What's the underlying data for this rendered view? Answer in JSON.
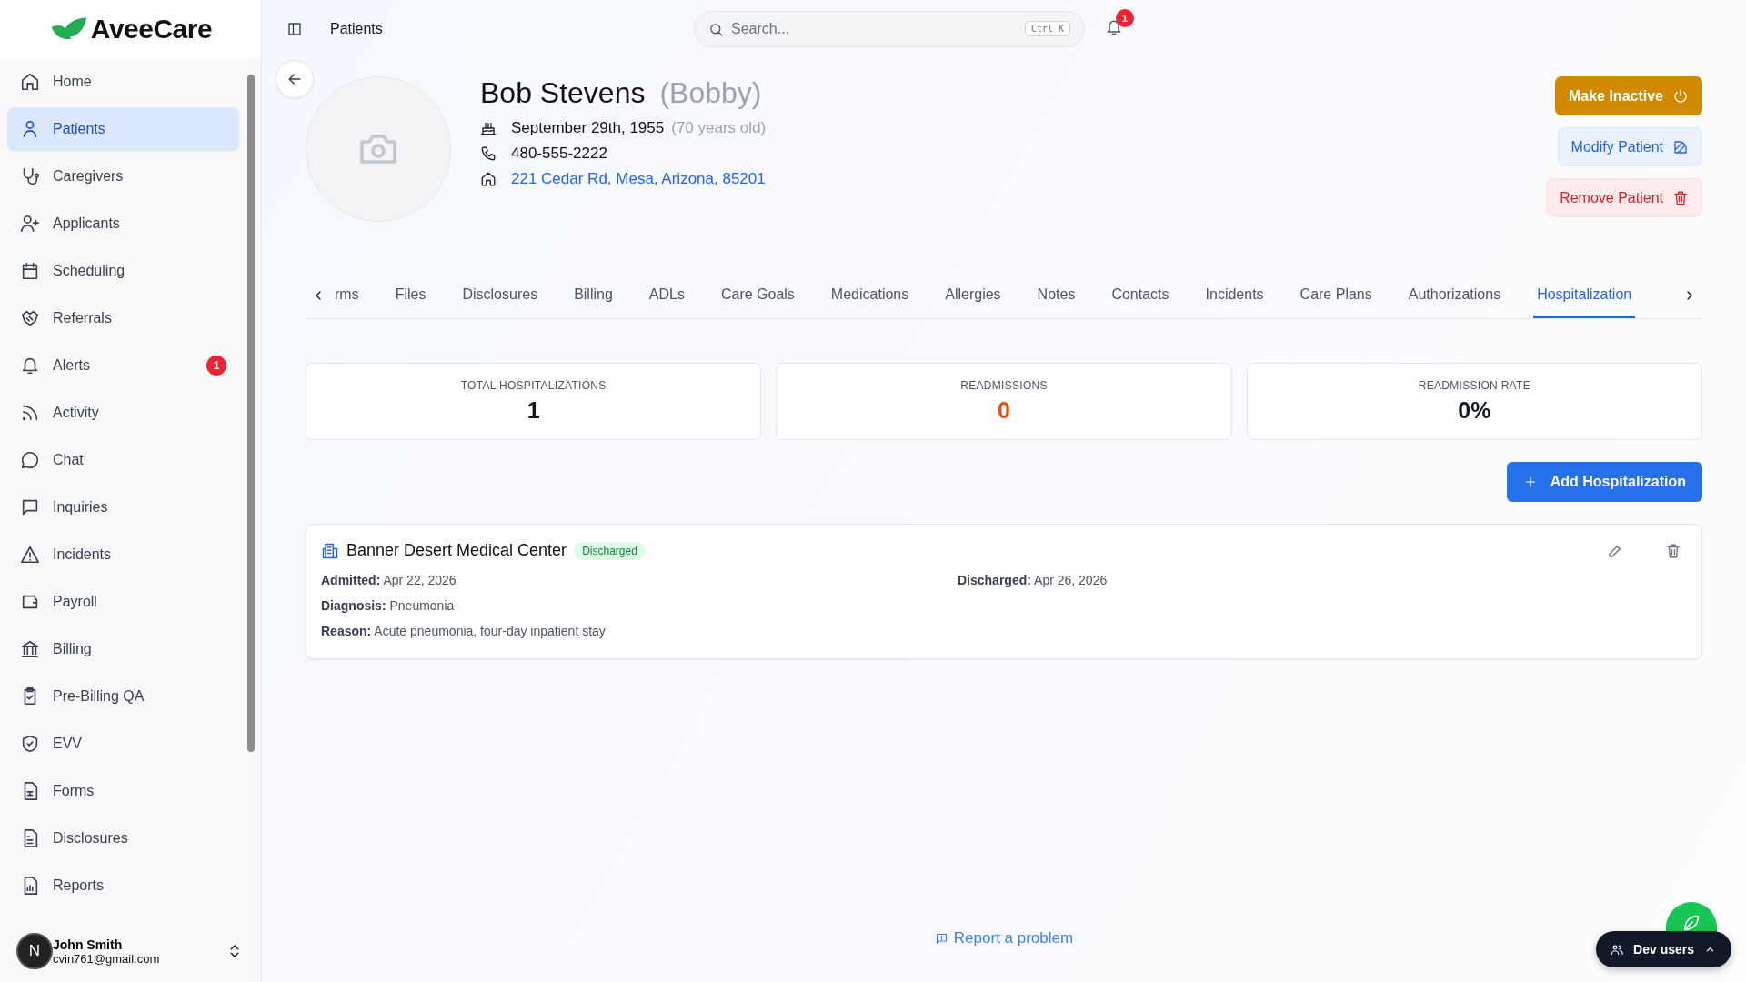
{
  "brand": "AveeCare",
  "sidebar": {
    "items": [
      {
        "label": "Home",
        "selected": false
      },
      {
        "label": "Patients",
        "selected": true
      },
      {
        "label": "Caregivers",
        "selected": false
      },
      {
        "label": "Applicants",
        "selected": false
      },
      {
        "label": "Scheduling",
        "selected": false
      },
      {
        "label": "Referrals",
        "selected": false
      },
      {
        "label": "Alerts",
        "selected": false,
        "badge": "1"
      },
      {
        "label": "Activity",
        "selected": false
      },
      {
        "label": "Chat",
        "selected": false
      },
      {
        "label": "Inquiries",
        "selected": false
      },
      {
        "label": "Incidents",
        "selected": false
      },
      {
        "label": "Payroll",
        "selected": false
      },
      {
        "label": "Billing",
        "selected": false
      },
      {
        "label": "Pre-Billing QA",
        "selected": false
      },
      {
        "label": "EVV",
        "selected": false
      },
      {
        "label": "Forms",
        "selected": false
      },
      {
        "label": "Disclosures",
        "selected": false
      },
      {
        "label": "Reports",
        "selected": false
      }
    ]
  },
  "user": {
    "initial": "N",
    "name": "John Smith",
    "email": "cvin761@gmail.com"
  },
  "header": {
    "breadcrumb": "Patients",
    "search": {
      "placeholder": "Search...",
      "shortcut": "Ctrl K"
    },
    "notifications": "1"
  },
  "patient": {
    "name": "Bob Stevens",
    "nickname": "(Bobby)",
    "birthdate": "September 29th, 1955",
    "age": "(70 years old)",
    "phone": "480-555-2222",
    "address": "221 Cedar Rd, Mesa, Arizona, 85201"
  },
  "actions": [
    {
      "label": "Make Inactive",
      "kind": "inactive"
    },
    {
      "label": "Modify Patient",
      "kind": "modify"
    },
    {
      "label": "Remove Patient",
      "kind": "remove"
    }
  ],
  "tabs": [
    {
      "label": "rms",
      "selected": false
    },
    {
      "label": "Files",
      "selected": false
    },
    {
      "label": "Disclosures",
      "selected": false
    },
    {
      "label": "Billing",
      "selected": false
    },
    {
      "label": "ADLs",
      "selected": false
    },
    {
      "label": "Care Goals",
      "selected": false
    },
    {
      "label": "Medications",
      "selected": false
    },
    {
      "label": "Allergies",
      "selected": false
    },
    {
      "label": "Notes",
      "selected": false
    },
    {
      "label": "Contacts",
      "selected": false
    },
    {
      "label": "Incidents",
      "selected": false
    },
    {
      "label": "Care Plans",
      "selected": false
    },
    {
      "label": "Authorizations",
      "selected": false
    },
    {
      "label": "Hospitalization",
      "selected": true
    }
  ],
  "stats": [
    {
      "label": "TOTAL HOSPITALIZATIONS",
      "value": "1",
      "kind": "normal"
    },
    {
      "label": "READMISSIONS",
      "value": "0",
      "kind": "alert"
    },
    {
      "label": "READMISSION RATE",
      "value": "0%",
      "kind": "normal"
    }
  ],
  "add_button": "Add Hospitalization",
  "hospitalizations": [
    {
      "facility": "Banner Desert Medical Center",
      "status": "Discharged",
      "rows": [
        {
          "cells": [
            {
              "label": "Admitted:",
              "value": "Apr 22, 2026"
            },
            {
              "label": "Discharged:",
              "value": "Apr 26, 2026"
            }
          ]
        },
        {
          "cells": [
            {
              "label": "Diagnosis:",
              "value": "Pneumonia"
            }
          ]
        },
        {
          "cells": [
            {
              "label": "Reason:",
              "value": "Acute pneumonia, four-day inpatient stay"
            }
          ]
        }
      ]
    }
  ],
  "footer": {
    "report": "Report a problem"
  },
  "dev_users": "Dev users"
}
